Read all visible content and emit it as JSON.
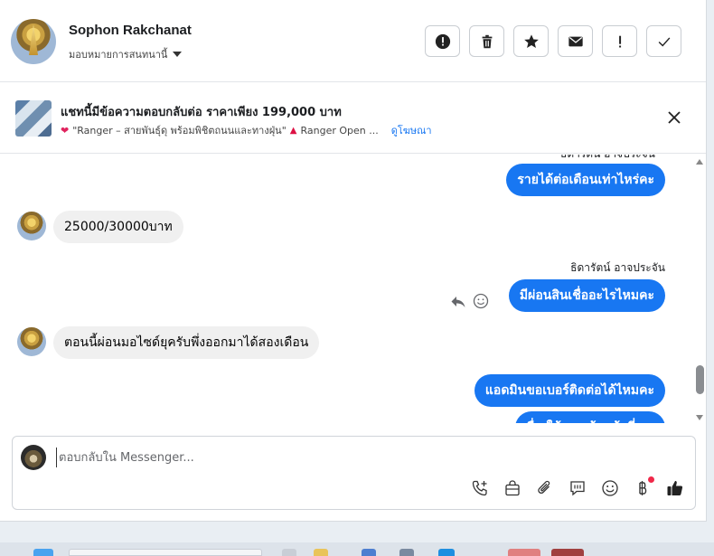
{
  "header": {
    "contact_name": "Sophon Rakchanat",
    "assign_label": "มอบหมายการสนทนานี้",
    "actions": [
      {
        "name": "spam-button",
        "icon": "alert-circle-icon"
      },
      {
        "name": "delete-button",
        "icon": "trash-icon"
      },
      {
        "name": "star-button",
        "icon": "star-icon"
      },
      {
        "name": "mail-button",
        "icon": "envelope-icon"
      },
      {
        "name": "follow-up-button",
        "icon": "exclamation-icon"
      },
      {
        "name": "done-button",
        "icon": "check-icon"
      }
    ]
  },
  "ad": {
    "title": "แชทนี้มีข้อความตอบกลับต่อ ราคาเพียง 199,000 บาท",
    "subtitle_part1": "\"Ranger – สายพันธุ์ดุ พร้อมพิชิตถนนและทางฝุ่น\"",
    "subtitle_part2": "Ranger Open ...",
    "link": "ดูโฆษณา"
  },
  "messages": {
    "cut_label": "ธิดารัตน์ อาจประจัน",
    "m1": "รายได้ต่อเดือนเท่าไหร่คะ",
    "m2": "25000/30000บาท",
    "sender_label": "ธิดารัตน์ อาจประจัน",
    "m3": "มีผ่อนสินเชื่ออะไรไหมคะ",
    "m4": "ตอนนี้ผ่อนมอไซด์ยุครับพึ่งออกมาได้สองเดือน",
    "m5": "แอดมินขอเบอร์ติดต่อได้ไหมคะ",
    "m6": "ชื่อ ให้ ... เจ้าหน้าที่ ..."
  },
  "composer": {
    "placeholder": "ตอบกลับใน Messenger..."
  },
  "colors": {
    "accent": "#1877f2",
    "incoming_bubble": "#f0f0f0",
    "notification_dot": "#f02849"
  }
}
